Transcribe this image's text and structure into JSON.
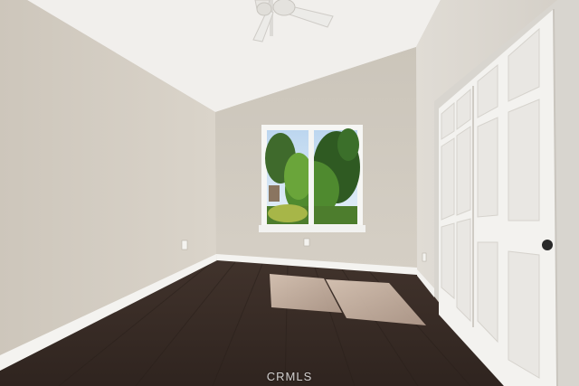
{
  "image": {
    "description_type": "empty bedroom photo",
    "watermark": "CRMLS"
  },
  "colors": {
    "ceiling": "#f1efec",
    "left_wall": "#d6d0c6",
    "back_wall": "#d2ccc2",
    "right_wall": "#dedad3",
    "floor": "#3a2d27",
    "baseboard": "#f4f3f0",
    "door": "#f3f2ef",
    "window_frame": "#f6f6f4"
  },
  "icons": [
    "ceiling-fan-icon",
    "door-knob-icon",
    "power-outlet-icon"
  ]
}
